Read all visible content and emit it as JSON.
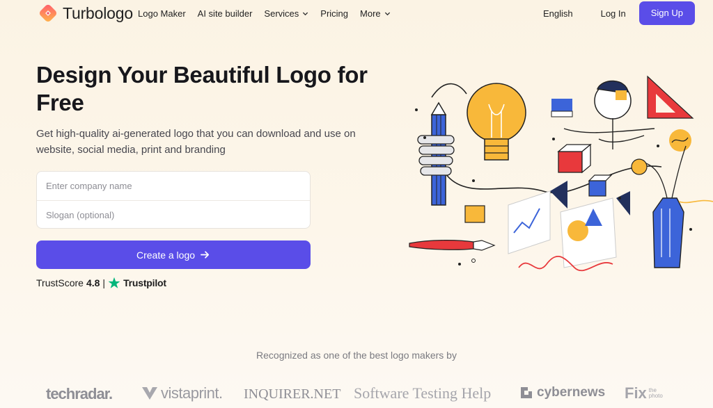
{
  "nav": {
    "brand": "Turbologo",
    "items": [
      {
        "label": "Logo Maker",
        "dropdown": false
      },
      {
        "label": "AI site builder",
        "dropdown": false
      },
      {
        "label": "Services",
        "dropdown": true
      },
      {
        "label": "Pricing",
        "dropdown": false
      },
      {
        "label": "More",
        "dropdown": true
      }
    ],
    "language": "English",
    "login": "Log In",
    "signup": "Sign Up"
  },
  "hero": {
    "title": "Design Your Beautiful Logo for Free",
    "subtitle": "Get high-quality ai-generated logo that you can download and use on website, social media, print and branding",
    "company_placeholder": "Enter company name",
    "slogan_placeholder": "Slogan (optional)",
    "cta_label": "Create a logo",
    "trust_label": "TrustScore",
    "trust_score": "4.8",
    "trust_sep": "|",
    "trust_brand": "Trustpilot"
  },
  "recognized": {
    "text": "Recognized as one of the best logo makers by",
    "brands": [
      "techradar.",
      "vistaprint.",
      "INQUIRER.NET",
      "Software Testing Help",
      "cybernews",
      "Fix",
      "the photo"
    ]
  },
  "colors": {
    "accent": "#5a4de8",
    "trustpilot_green": "#00b67a",
    "bg": "#fbf3e4"
  }
}
